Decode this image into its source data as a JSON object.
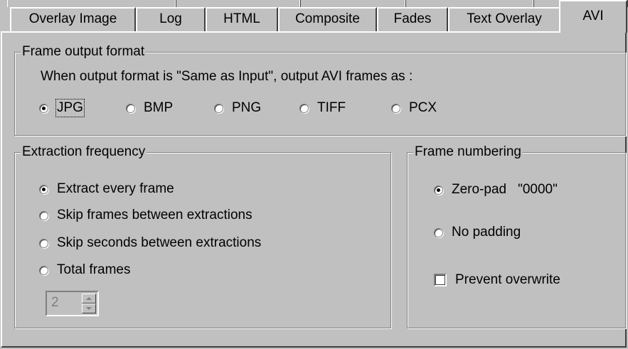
{
  "tabs": [
    {
      "label": "Overlay Image"
    },
    {
      "label": "Log"
    },
    {
      "label": "HTML"
    },
    {
      "label": "Composite"
    },
    {
      "label": "Fades"
    },
    {
      "label": "Text Overlay"
    },
    {
      "label": "AVI",
      "active": true
    }
  ],
  "frame_output": {
    "title": "Frame output format",
    "description": "When output format is \"Same as Input\", output AVI frames as :",
    "options": [
      {
        "label": "JPG",
        "selected": true
      },
      {
        "label": "BMP",
        "selected": false
      },
      {
        "label": "PNG",
        "selected": false
      },
      {
        "label": "TIFF",
        "selected": false
      },
      {
        "label": "PCX",
        "selected": false
      }
    ]
  },
  "extraction": {
    "title": "Extraction frequency",
    "options": [
      {
        "label": "Extract every frame",
        "selected": true
      },
      {
        "label": "Skip frames between extractions",
        "selected": false
      },
      {
        "label": "Skip seconds between extractions",
        "selected": false
      },
      {
        "label": "Total frames",
        "selected": false
      }
    ],
    "spinner_value": "2"
  },
  "numbering": {
    "title": "Frame numbering",
    "zero_pad_label": "Zero-pad",
    "zero_pad_example": "\"0000\"",
    "zero_pad_selected": true,
    "no_padding_label": "No padding",
    "no_padding_selected": false,
    "prevent_overwrite_label": "Prevent overwrite",
    "prevent_overwrite_checked": false
  }
}
